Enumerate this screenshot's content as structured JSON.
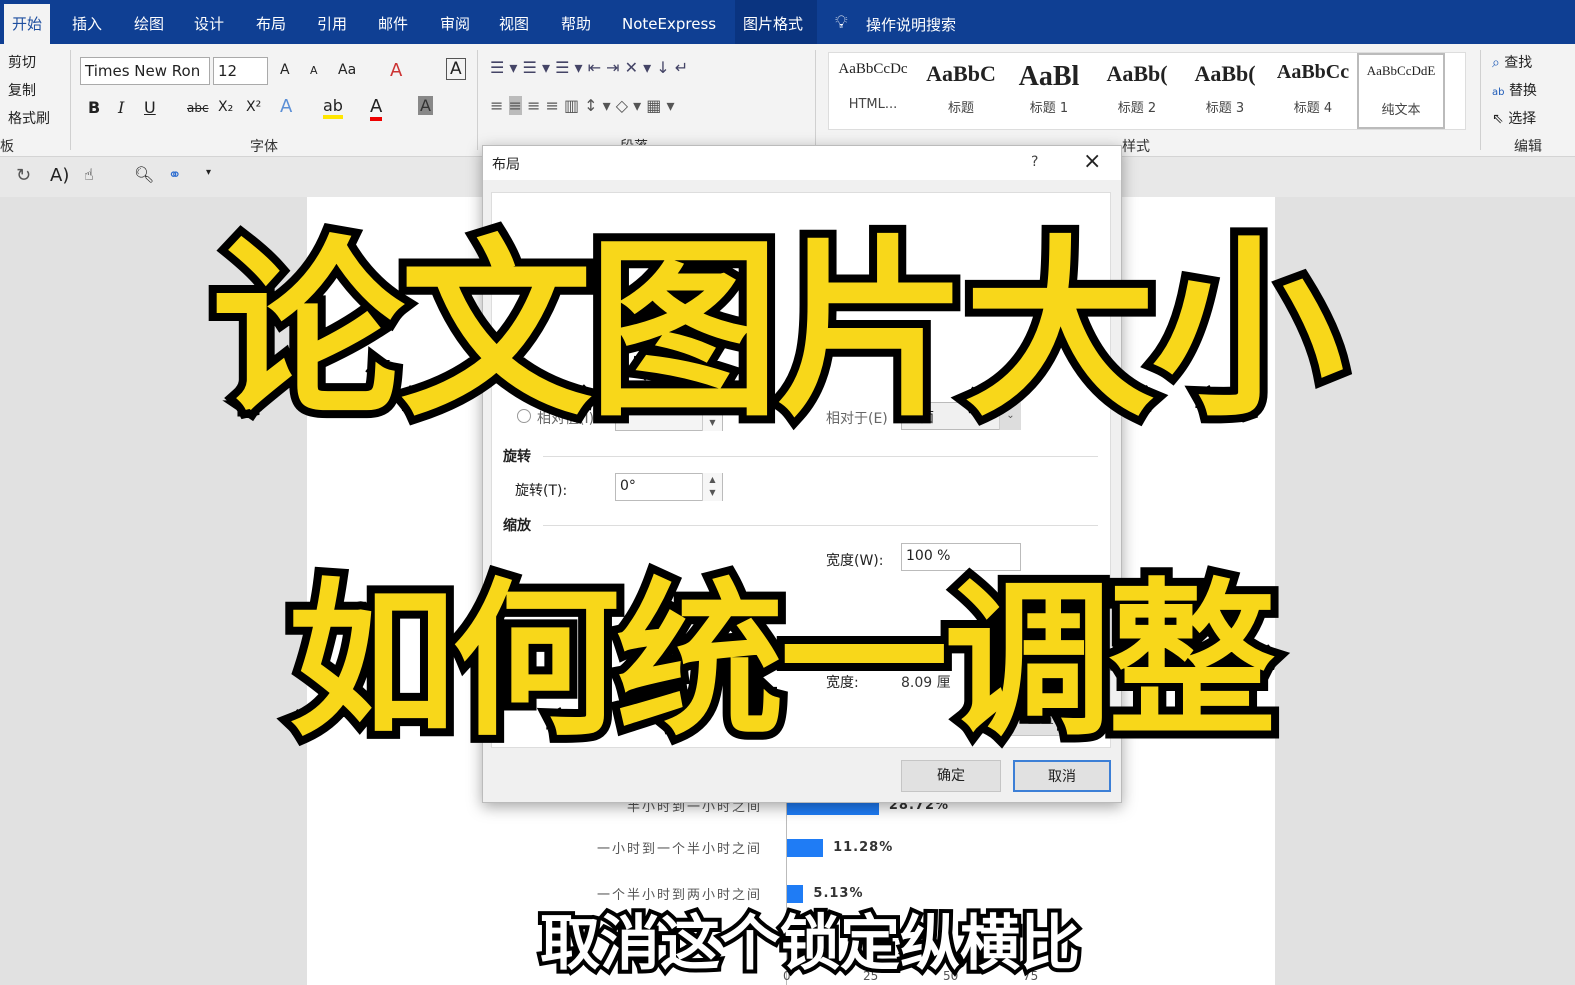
{
  "tabs": [
    "开始",
    "插入",
    "绘图",
    "设计",
    "布局",
    "引用",
    "邮件",
    "审阅",
    "视图",
    "帮助",
    "NoteExpress",
    "图片格式"
  ],
  "tell_me": "操作说明搜索",
  "clipboard": {
    "cut": "剪切",
    "copy": "复制",
    "format_painter": "格式刷",
    "label": "板"
  },
  "font": {
    "name": "Times New Ron",
    "size": "12",
    "label": "字体",
    "grow": "A",
    "shrink": "A",
    "case": "Aa",
    "bold": "B",
    "italic": "I",
    "underline": "U",
    "strike": "abc",
    "sub": "X₂",
    "sup": "X²"
  },
  "paragraph": {
    "label": "段落"
  },
  "styles": {
    "label": "样式",
    "items": [
      {
        "preview": "AaBbCcDc",
        "name": "HTML..."
      },
      {
        "preview": "AaBbC",
        "name": "标题"
      },
      {
        "preview": "AaBl",
        "name": "标题 1"
      },
      {
        "preview": "AaBb(",
        "name": "标题 2"
      },
      {
        "preview": "AaBb(",
        "name": "标题 3"
      },
      {
        "preview": "AaBbCc",
        "name": "标题 4"
      },
      {
        "preview": "AaBbCcDdE",
        "name": "纯文本"
      }
    ]
  },
  "editing": {
    "find": "查找",
    "replace": "替换",
    "select": "选择",
    "label": "编辑"
  },
  "dialog": {
    "title": "布局",
    "help": "?",
    "close": "×",
    "relative_label": "相对值(I)",
    "relative_to_label": "相对于(E)",
    "relative_to_value": "页面",
    "rotation_section": "旋转",
    "rotation_label": "旋转(T):",
    "rotation_value": "0°",
    "scale_section": "缩放",
    "scale_width_label": "宽度(W):",
    "scale_width_value": "100 %",
    "orig_width_label": "宽度:",
    "orig_width_value": "8.09 厘",
    "reset": "重置(S)",
    "ok": "确定",
    "cancel": "取消"
  },
  "overlay": {
    "line1": "论文图片大小",
    "line2": "如何统一调整",
    "subtitle": "取消这个锁定纵横比"
  },
  "chart_data": {
    "type": "bar",
    "orientation": "horizontal",
    "categories": [
      "半小时到一小时之间",
      "一小时到一个半小时之间",
      "一个半小时到两小时之间"
    ],
    "values": [
      28.72,
      11.28,
      5.13
    ],
    "value_labels": [
      "28.72%",
      "11.28%",
      "5.13%"
    ],
    "xticks": [
      "0",
      "25",
      "50",
      "75"
    ],
    "color": "#1f7cf5"
  }
}
